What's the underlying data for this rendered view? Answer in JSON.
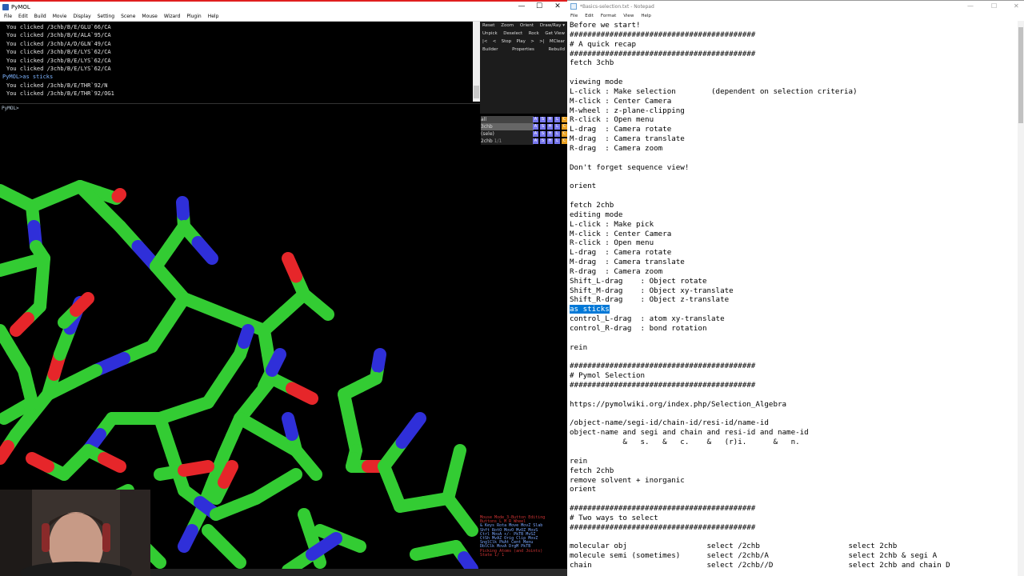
{
  "pymol": {
    "title": "PyMOL",
    "window_controls": [
      "—",
      "☐",
      "✕"
    ],
    "menu": [
      "File",
      "Edit",
      "Build",
      "Movie",
      "Display",
      "Setting",
      "Scene",
      "Mouse",
      "Wizard",
      "Plugin",
      "Help"
    ],
    "console_lines": [
      "You clicked /3chb/B/E/GLU`66/CA",
      "You clicked /3chb/B/E/ALA`95/CA",
      "You clicked /3chb/A/D/GLN`49/CA",
      "You clicked /3chb/B/E/LYS`62/CA",
      "You clicked /3chb/B/E/LYS`62/CA",
      "You clicked /3chb/B/E/LYS`62/CA"
    ],
    "console_command": "PyMOL>as sticks",
    "console_after": [
      "You clicked /3chb/B/E/THR`92/N",
      "You clicked /3chb/B/E/THR`92/OG1"
    ],
    "cmd_prompt": "PyMOL>",
    "ext_rows": [
      [
        "Reset",
        "Zoom",
        "Orient",
        "Draw/Ray ▾"
      ],
      [
        "Unpick",
        "Deselect",
        "Rock",
        "Get View"
      ],
      [
        "|<",
        "<",
        "Stop",
        "Play",
        ">",
        ">|",
        "MClear"
      ],
      [
        "Builder",
        "Properties",
        "Rebuild"
      ]
    ],
    "objects": [
      {
        "name": "all",
        "count": ""
      },
      {
        "name": "3chb",
        "count": ""
      },
      {
        "name": "(sele)",
        "count": ""
      },
      {
        "name": "2chb",
        "count": "1/1"
      }
    ],
    "obj_buttons": [
      "A",
      "S",
      "H",
      "L",
      "C"
    ],
    "mouse_panel": [
      "Mouse Mode 3-Button Editing",
      "Buttons  L    M    R  Wheel",
      "& Keys Rota Move MovZ Slab",
      "  Shft RotO MovO MvOZ MovS",
      "  Ctrl MovA +/-  PkTB MvSZ",
      "  CtSh MvAZ Orig Clip MovZ",
      " SnglClk PkAt Cent Menu",
      " DblClk MovA DrgM PkTB",
      " Picking Atoms (and Joints)",
      "State    1/   1"
    ]
  },
  "notepad": {
    "title": "*Basics-selection.txt - Notepad",
    "window_controls": [
      "—",
      "☐",
      "✕"
    ],
    "menu": [
      "File",
      "Edit",
      "Format",
      "View",
      "Help"
    ],
    "lines": [
      "Before we start!",
      "##########################################",
      "# A quick recap",
      "##########################################",
      "fetch 3chb",
      "",
      "viewing mode",
      "L-click : Make selection        (dependent on selection criteria)",
      "M-click : Center Camera",
      "M-wheel : z-plane-clipping",
      "R-click : Open menu",
      "L-drag  : Camera rotate",
      "M-drag  : Camera translate",
      "R-drag  : Camera zoom",
      "",
      "Don't forget sequence view!",
      "",
      "orient",
      "",
      "fetch 2chb",
      "editing mode",
      "L-click : Make pick",
      "M-click : Center Camera",
      "R-click : Open menu",
      "L-drag  : Camera rotate",
      "M-drag  : Camera translate",
      "R-drag  : Camera zoom",
      "Shift_L-drag    : Object rotate",
      "Shift_M-drag    : Object xy-translate",
      "Shift_R-drag    : Object z-translate",
      "as sticks",
      "control_L-drag  : atom xy-translate",
      "control_R-drag  : bond rotation",
      "",
      "rein",
      "",
      "##########################################",
      "# Pymol Selection",
      "##########################################",
      "",
      "https://pymolwiki.org/index.php/Selection_Algebra",
      "",
      "/object-name/segi-id/chain-id/resi-id/name-id",
      "object-name and segi and chain and resi-id and name-id",
      "            &   s.   &   c.    &   (r)i.      &   n.",
      "",
      "rein",
      "fetch 2chb",
      "remove solvent + inorganic",
      "orient",
      "",
      "##########################################",
      "# Two ways to select",
      "##########################################",
      "",
      "molecular obj                  select /2chb                    select 2chb",
      "molecule semi (sometimes)      select /2chb/A                  select 2chb & segi A",
      "chain                          select /2chb//D                 select 2chb and chain D"
    ],
    "highlighted_line_index": 30
  },
  "colors": {
    "carbon": "#33cc33",
    "nitrogen": "#2f2fd9",
    "oxygen": "#e6262a",
    "selection_highlight": "#0078d7"
  }
}
